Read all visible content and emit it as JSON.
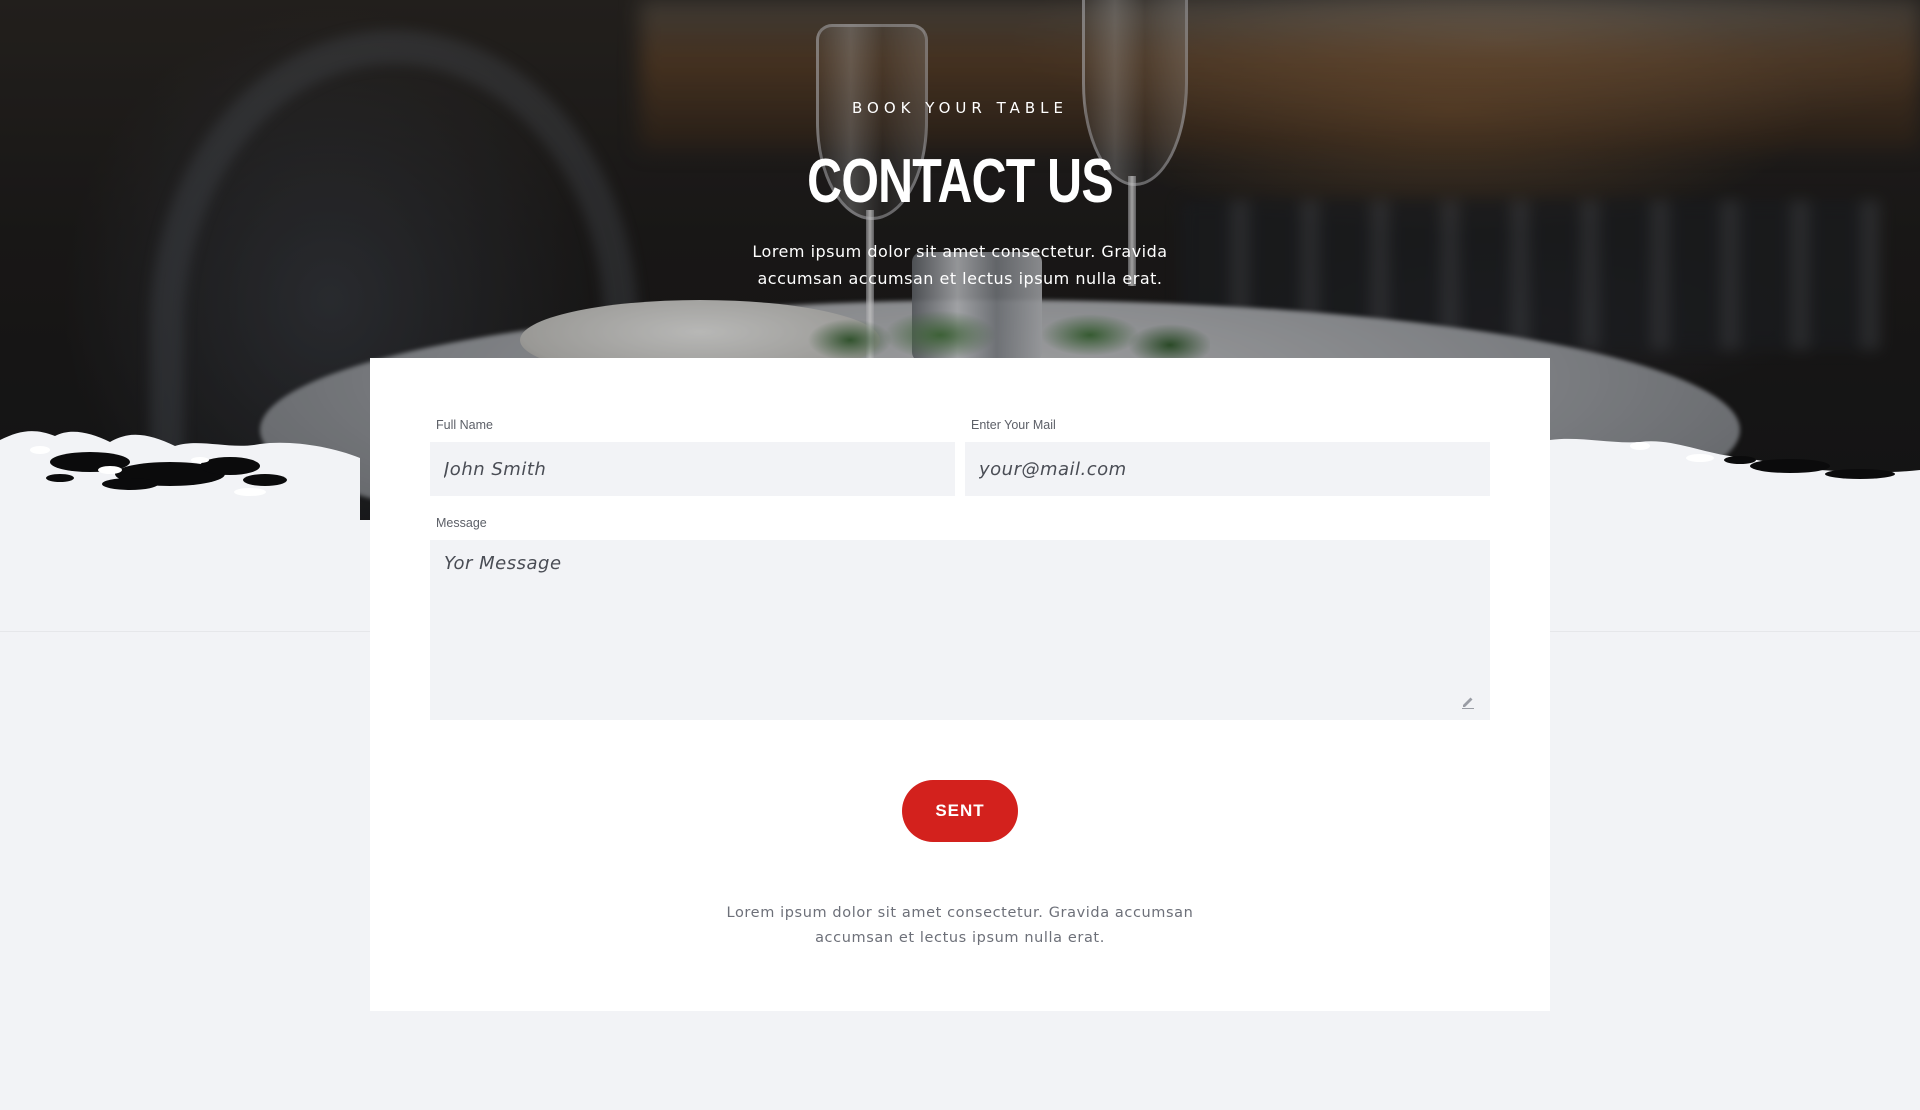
{
  "hero": {
    "eyebrow": "BOOK YOUR TABLE",
    "title": "CONTACT US",
    "intro": "Lorem ipsum dolor sit amet consectetur. Gravida accumsan accumsan et lectus ipsum nulla erat."
  },
  "form": {
    "full_name": {
      "label": "Full Name",
      "placeholder": "John Smith",
      "value": ""
    },
    "email": {
      "label": "Enter Your Mail",
      "placeholder": "your@mail.com",
      "value": ""
    },
    "message": {
      "label": "Message",
      "placeholder": "Yor Message",
      "value": ""
    },
    "submit_label": "SENT",
    "note": "Lorem ipsum dolor sit amet consectetur. Gravida accumsan accumsan et lectus ipsum nulla erat."
  },
  "colors": {
    "accent": "#d3211d",
    "page_background": "#f2f3f6",
    "card_background": "#ffffff",
    "field_background": "#f2f3f6"
  },
  "icons": {
    "textarea_resize": "pencil-icon"
  }
}
